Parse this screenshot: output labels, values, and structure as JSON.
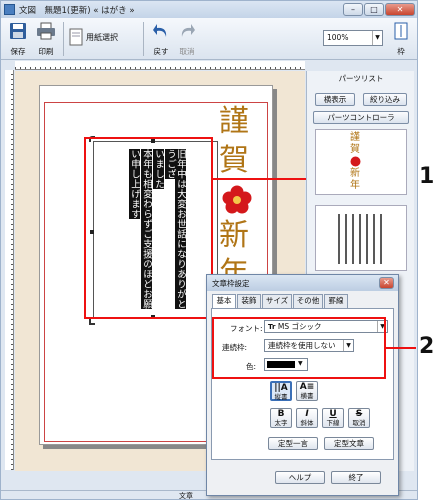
{
  "window": {
    "title": "文図　無題1(更新) « はがき »",
    "min": "–",
    "max": "□",
    "close": "✕"
  },
  "toolbar": {
    "save": "保存",
    "print": "印刷",
    "paper": "用紙選択",
    "undo": "戻す",
    "redo": "取消",
    "zoom": "100%",
    "fit": "枠"
  },
  "side_panel": {
    "title": "パーツリスト",
    "show_button": "横表示",
    "filter_button": "絞り込み",
    "controller_button": "パーツコントローラ"
  },
  "thumb": {
    "text": [
      "謹",
      "賀",
      "新",
      "年"
    ]
  },
  "card": {
    "big_text": [
      "謹",
      "賀",
      "新",
      "年"
    ],
    "body_lines": [
      "旧年中は大変お世話になりありがとうござ",
      "いました",
      "本年も相変わらずご支援のほどお願",
      "い申し上げます"
    ]
  },
  "callouts": {
    "one": "1",
    "two": "2"
  },
  "dialog": {
    "title": "文章枠設定",
    "close": "✕",
    "tabs": [
      "基本",
      "装飾",
      "サイズ",
      "その他",
      "罫線"
    ],
    "font_label": "フォント:",
    "font_value": "MS ゴシック",
    "font_prefix": "Tr",
    "line_label": "連続枠:",
    "line_value": "連続枠を使用しない",
    "color_label": "色:",
    "vertical": "縦書",
    "horizontal": "横書",
    "bold": "太字",
    "italic": "斜体",
    "underline": "下線",
    "strike": "取消",
    "preset_phrase": "定型一言",
    "preset_text": "定型文章",
    "help": "ヘルプ",
    "finish": "終了"
  },
  "status": {
    "text": "文章"
  },
  "colors": {
    "accent_red": "#e11111",
    "gold": "#b07516",
    "plum": "#d4181b"
  }
}
